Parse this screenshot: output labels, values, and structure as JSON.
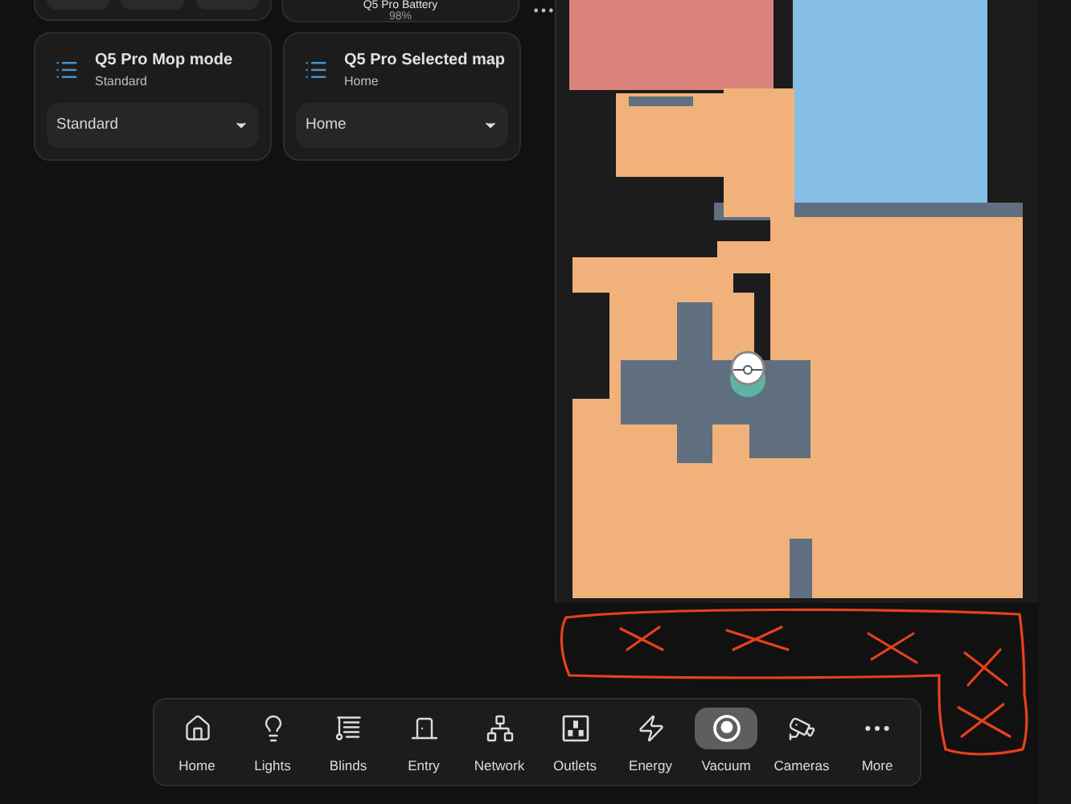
{
  "battery_card": {
    "title": "Q5 Pro Battery",
    "value": "98%"
  },
  "select_cards": [
    {
      "title": "Q5 Pro Mop mode",
      "state": "Standard",
      "value": "Standard"
    },
    {
      "title": "Q5 Pro Selected map",
      "state": "Home",
      "value": "Home"
    }
  ],
  "nav": [
    {
      "label": "Home",
      "selected": false
    },
    {
      "label": "Lights",
      "selected": false
    },
    {
      "label": "Blinds",
      "selected": false
    },
    {
      "label": "Entry",
      "selected": false
    },
    {
      "label": "Network",
      "selected": false
    },
    {
      "label": "Outlets",
      "selected": false
    },
    {
      "label": "Energy",
      "selected": false
    },
    {
      "label": "Vacuum",
      "selected": true
    },
    {
      "label": "Cameras",
      "selected": false
    },
    {
      "label": "More",
      "selected": false
    }
  ]
}
